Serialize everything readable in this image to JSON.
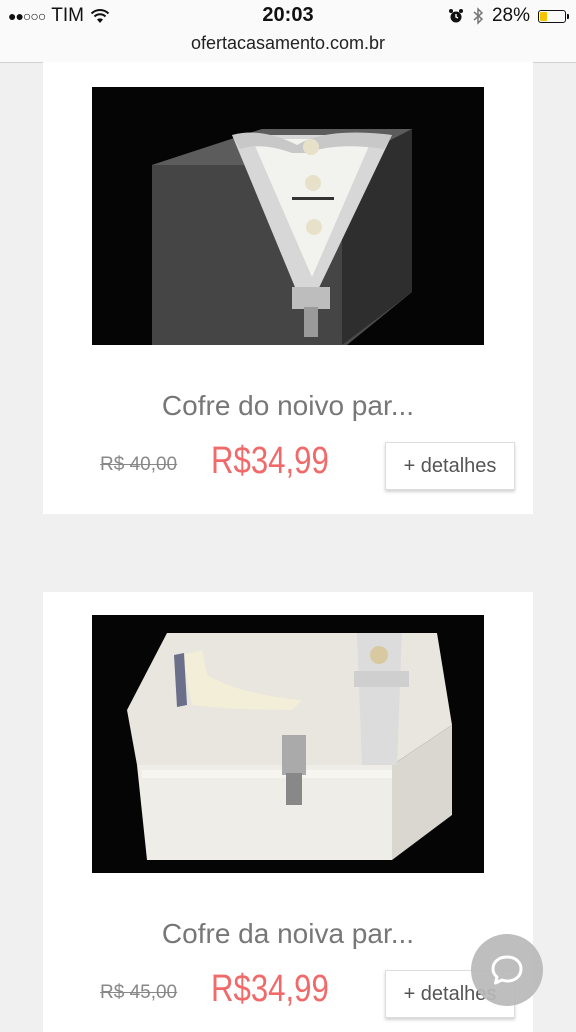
{
  "status": {
    "carrier": "TIM",
    "time": "20:03",
    "battery": "28%"
  },
  "url": "ofertacasamento.com.br",
  "products": [
    {
      "title": "Cofre do noivo par...",
      "old_price": "R$ 40,00",
      "price": "R$34,99",
      "details_label": "+ detalhes"
    },
    {
      "title": "Cofre da noiva par...",
      "old_price": "R$ 45,00",
      "price": "R$34,99",
      "details_label": "+ detalhes"
    }
  ],
  "colors": {
    "price": "#f06a6a",
    "battery": "#f5c400"
  },
  "icons": {
    "wifi": "wifi-icon",
    "alarm": "alarm-icon",
    "bluetooth": "bluetooth-icon",
    "battery": "battery-icon",
    "chat": "chat-bubble-icon"
  }
}
